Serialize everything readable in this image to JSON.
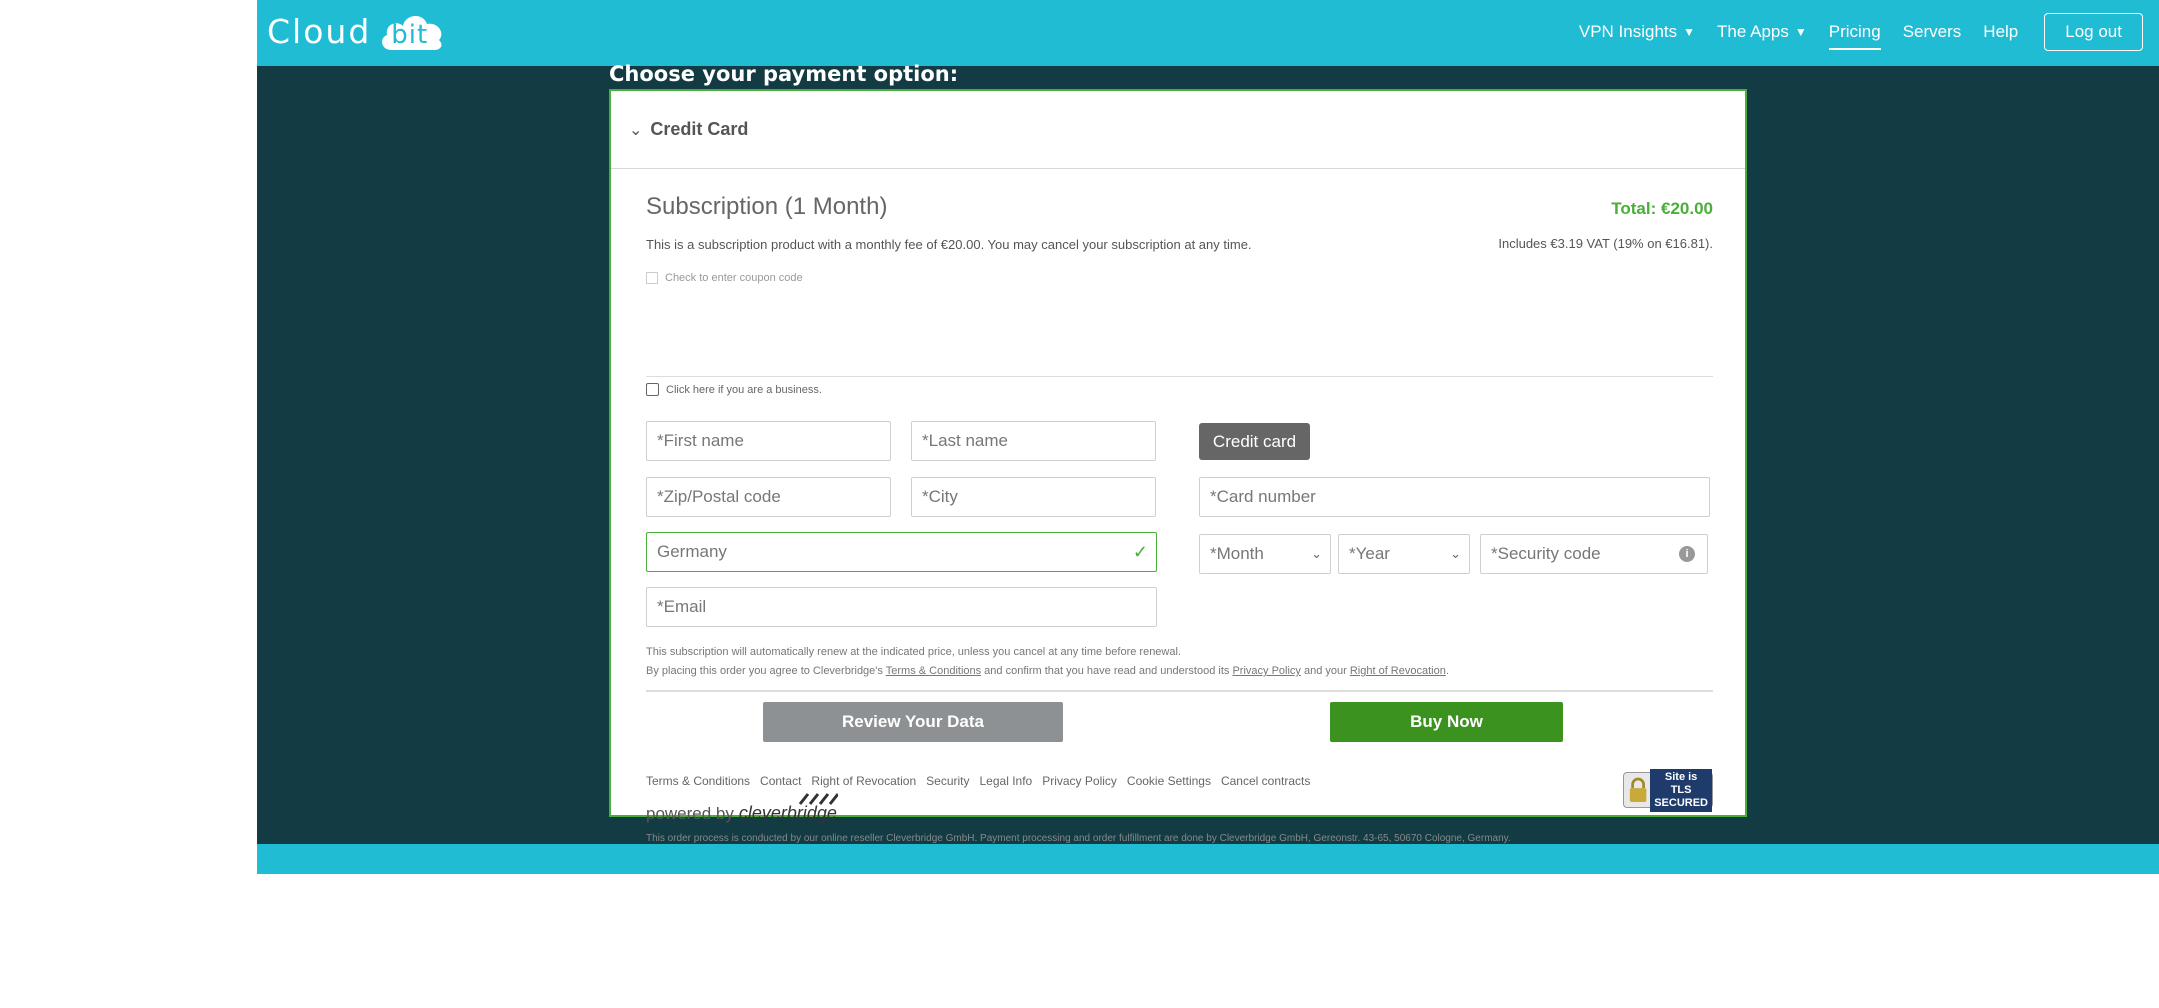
{
  "header": {
    "logo_cloud": "Cloud",
    "logo_bit": "bit",
    "nav": [
      {
        "label": "VPN Insights",
        "dropdown": true
      },
      {
        "label": "The Apps",
        "dropdown": true
      },
      {
        "label": "Pricing",
        "active": true
      },
      {
        "label": "Servers"
      },
      {
        "label": "Help"
      }
    ],
    "logout_label": "Log out"
  },
  "page": {
    "choose_title": "Choose your payment option:"
  },
  "payment": {
    "method_label": "Credit Card",
    "subscription_title": "Subscription (1 Month)",
    "subscription_desc": "This is a subscription product with a monthly fee of €20.00. You may cancel your subscription at any time.",
    "total": "Total: €20.00",
    "vat": "Includes €3.19 VAT (19% on €16.81).",
    "coupon_label": "Check to enter coupon code",
    "business_label": "Click here if you are a business.",
    "fields": {
      "first_name": "*First name",
      "last_name": "*Last name",
      "zip": "*Zip/Postal code",
      "city": "*City",
      "country": "Germany",
      "email": "*Email",
      "card_number": "*Card number",
      "month": "*Month",
      "year": "*Year",
      "security_code": "*Security code"
    },
    "credit_card_tab": "Credit card",
    "legal_renew": "This subscription will automatically renew at the indicated price, unless you cancel at any time before renewal.",
    "legal_agree_pre": "By placing this order you agree to Cleverbridge's ",
    "legal_terms": "Terms & Conditions",
    "legal_agree_mid": " and confirm that you have read and understood its ",
    "legal_privacy": "Privacy Policy",
    "legal_and": " and your ",
    "legal_revocation": "Right of Revocation",
    "legal_end": ".",
    "review_button": "Review Your Data",
    "buy_button": "Buy Now"
  },
  "footer": {
    "links": [
      "Terms & Conditions",
      "Contact",
      "Right of Revocation",
      "Security",
      "Legal Info",
      "Privacy Policy",
      "Cookie Settings",
      "Cancel contracts"
    ],
    "powered_by": "powered by",
    "cleverbridge": "cleverbridge",
    "disclaimer": "This order process is conducted by our online reseller Cleverbridge GmbH. Payment processing and order fulfillment are done by Cleverbridge GmbH, Gereonstr. 43-65, 50670 Cologne, Germany.",
    "tls_line1": "Site is TLS",
    "tls_line2": "SECURED"
  },
  "colors": {
    "header_bg": "#1fbcd4",
    "dark_bg": "#133b44",
    "accent_green": "#4aae3a",
    "buy_green": "#3c921f"
  }
}
